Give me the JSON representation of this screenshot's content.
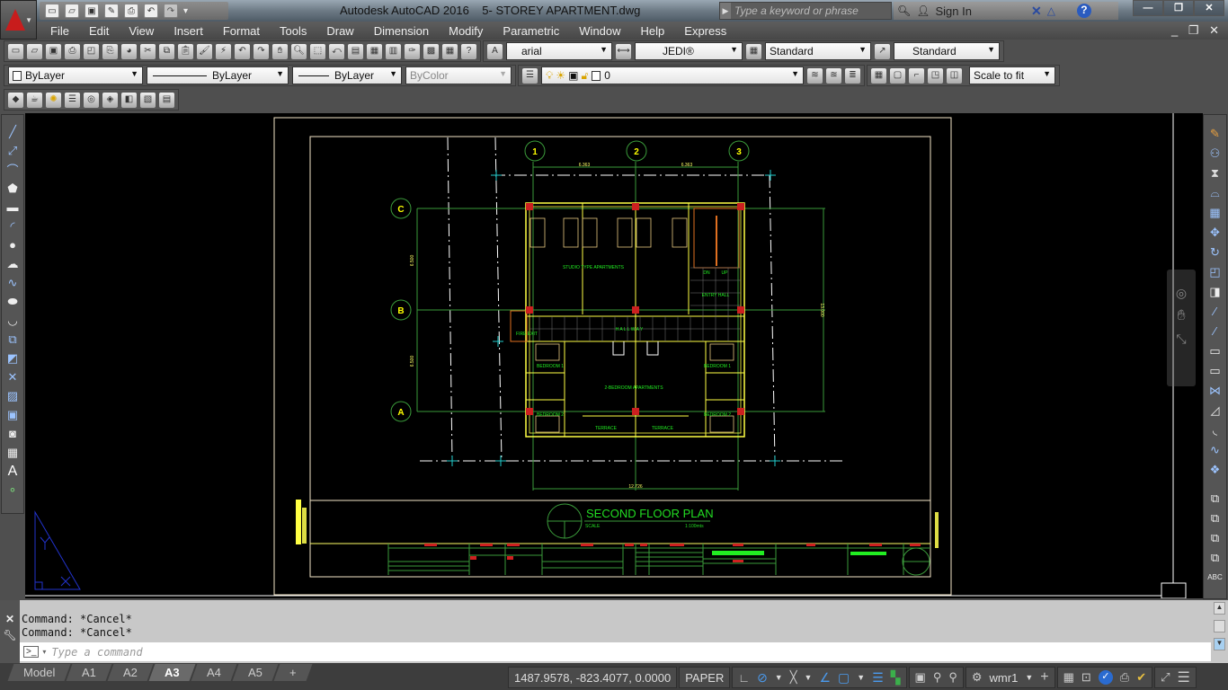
{
  "titlebar": {
    "app_name": "Autodesk AutoCAD 2016",
    "file_name": "5- STOREY APARTMENT.dwg",
    "search_placeholder": "Type a keyword or phrase",
    "sign_in": "Sign In"
  },
  "menu": [
    "File",
    "Edit",
    "View",
    "Insert",
    "Format",
    "Tools",
    "Draw",
    "Dimension",
    "Modify",
    "Parametric",
    "Window",
    "Help",
    "Express"
  ],
  "toolbar1": {
    "text_style": "arial",
    "dim_style": "JEDI®",
    "table_style": "Standard",
    "mleader_style": "Standard"
  },
  "toolbar2": {
    "color": "ByLayer",
    "linetype": "ByLayer",
    "lineweight": "ByLayer",
    "plotstyle": "ByColor",
    "layer": "0",
    "viewport_scale": "Scale to fit"
  },
  "drawing": {
    "title": "SECOND FLOOR PLAN",
    "scale_label": "SCALE",
    "scale_value": "1:100mts",
    "grid_cols": [
      "1",
      "2",
      "3"
    ],
    "grid_rows": [
      "C",
      "B",
      "A"
    ],
    "dims_top": [
      "6.363",
      "6.363"
    ],
    "dim_bottom": "12.726",
    "dims_left": [
      "6.500",
      "6.500"
    ],
    "dim_right": "13.000",
    "labels": {
      "studio": "STUDIO TYPE APARTMENTS",
      "two_bed": "2-BEDROOM APARTMENTS",
      "hallway": "H A L L W A Y",
      "entry": "ENTRY HALL",
      "fire_exit": "FIRE EXIT",
      "bedroom1": "BEDROOM 1",
      "bedroom2": "BEDROOM 2",
      "terrace": "TERRACE",
      "dn": "DN",
      "up": "UP"
    }
  },
  "command": {
    "history": [
      "Command: *Cancel*",
      "Command: *Cancel*"
    ],
    "placeholder": "Type a command"
  },
  "layout_tabs": [
    "Model",
    "A1",
    "A2",
    "A3",
    "A4",
    "A5"
  ],
  "active_tab": "A3",
  "status": {
    "coords": "1487.9578, -823.4077, 0.0000",
    "space": "PAPER",
    "workspace": "wmr1"
  }
}
